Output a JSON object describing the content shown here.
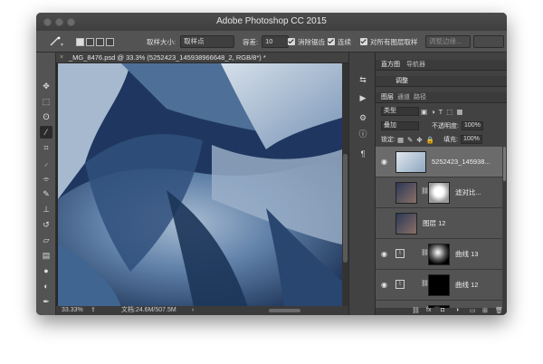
{
  "window": {
    "title": "Adobe Photoshop CC 2015"
  },
  "options_bar": {
    "sample_size_label": "取样大小:",
    "sample_size_value": "取样点",
    "tolerance_label": "容差:",
    "tolerance_value": "10",
    "antialias_label": "消除锯齿",
    "contiguous_label": "连续",
    "all_layers_label": "对所有图层取样",
    "refine_edge_label": "调整边缘..."
  },
  "document": {
    "tab_title": "_MG_8476.psd @ 33.3% (5252423_145938966648_2, RGB/8*) *",
    "zoom": "33.33%",
    "doc_size": "文档:24.6M/507.5M"
  },
  "panels": {
    "tabs_top": [
      "直方图",
      "导航器"
    ],
    "tabs_mid": [
      "调整"
    ],
    "tabs_layers": [
      "图层",
      "通道",
      "路径"
    ],
    "filter_kind": "类型",
    "blend_mode": "叠加",
    "opacity_label": "不透明度:",
    "opacity_value": "100%",
    "lock_label": "锁定:",
    "fill_label": "填充:",
    "fill_value": "100%"
  },
  "layers": [
    {
      "name": "5252423_145938...",
      "selected": true
    },
    {
      "name": "滤对比..."
    },
    {
      "name": "图层 12"
    },
    {
      "name": "曲线 13"
    },
    {
      "name": "曲线 12"
    },
    {
      "name": "曲线 11"
    }
  ],
  "colors": {
    "accent": "#6b6b6b",
    "panel": "#535353",
    "chrome": "#3a3a3a"
  }
}
